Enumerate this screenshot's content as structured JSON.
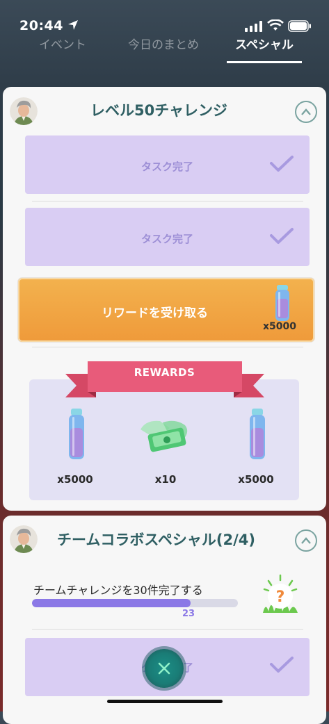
{
  "status_bar": {
    "time": "20:44"
  },
  "tabs": [
    {
      "label": "イベント"
    },
    {
      "label": "今日のまとめ"
    },
    {
      "label": "スペシャル"
    }
  ],
  "card1": {
    "title": "レベル50チャレンジ",
    "tasks": [
      {
        "label": "タスク完了"
      },
      {
        "label": "タスク完了"
      }
    ],
    "claim": {
      "label": "リワードを受け取る",
      "quantity": "x5000"
    },
    "rewards": {
      "banner": "REWARDS",
      "items": [
        {
          "icon": "potion-icon",
          "quantity": "x5000"
        },
        {
          "icon": "ticket-icon",
          "quantity": "x10"
        },
        {
          "icon": "potion-icon",
          "quantity": "x5000"
        }
      ]
    }
  },
  "card2": {
    "title": "チームコラボスペシャル(2/4)",
    "goal": {
      "text": "チームチャレンジを30件完了する",
      "current": "23",
      "progress_fraction": 0.77
    },
    "tasks": [
      {
        "label": "タスク完了"
      }
    ]
  },
  "colors": {
    "accent_purple": "#8b78e6",
    "claim_orange": "#ef9a3a",
    "ribbon_pink": "#e85b7a",
    "teal_title": "#2f5f63"
  }
}
